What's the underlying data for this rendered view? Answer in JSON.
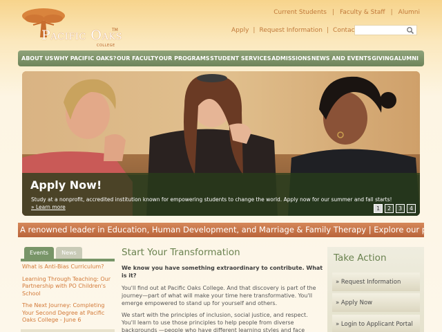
{
  "brand": {
    "logo_text": "Pacific Oaks",
    "logo_sub": "COLLEGE",
    "logo_tm": "TM"
  },
  "header": {
    "top_links": [
      "Current Students",
      "Faculty & Staff",
      "Alumni"
    ],
    "util_links": [
      "Apply",
      "Request Information",
      "Contact Us"
    ],
    "search_placeholder": ""
  },
  "nav": {
    "items": [
      "ABOUT US",
      "WHY PACIFIC OAKS?",
      "OUR FACULTY",
      "OUR PROGRAMS",
      "STUDENT SERVICES",
      "ADMISSIONS",
      "NEWS AND EVENTS",
      "GIVING",
      "ALUMNI"
    ]
  },
  "hero": {
    "title": "Apply Now!",
    "description": "Study at a nonprofit, accredited institution known for empowering students to change the world. Apply now for our summer and fall starts!",
    "learn_more": "» Learn more",
    "pager": [
      "1",
      "2",
      "3",
      "4"
    ],
    "active_slide": 1
  },
  "banner": {
    "text": "A renowned leader in Education, Human Development, and Marriage & Family Therapy | Explore our programs"
  },
  "news_panel": {
    "tabs": [
      "Events",
      "News"
    ],
    "items": [
      "What is Anti-Bias Curriculum?",
      "Learning Through Teaching: Our Partnership with PO Children's School",
      "The Next Journey: Completing Your Second Degree at Pacific Oaks College - June 6"
    ]
  },
  "main": {
    "title": "Start Your Transformation",
    "lead": "We know you have something extraordinary to contribute. What is it?",
    "paragraphs": [
      "You'll find out at Pacific Oaks College. And that discovery is part of the journey—part of what will make your time here transformative. You'll emerge empowered to stand up for yourself and others.",
      "We start with the principles of inclusion, social justice, and respect. You'll learn to use those principles to help people from diverse backgrounds —people who have different learning styles and face different"
    ]
  },
  "take_action": {
    "title": "Take Action",
    "items": [
      "» Request Information",
      "» Apply Now",
      "» Login to Applicant Portal"
    ]
  },
  "colors": {
    "nav_green": "#789568",
    "accent_orange": "#d27836",
    "banner_orange": "#c0703f"
  }
}
